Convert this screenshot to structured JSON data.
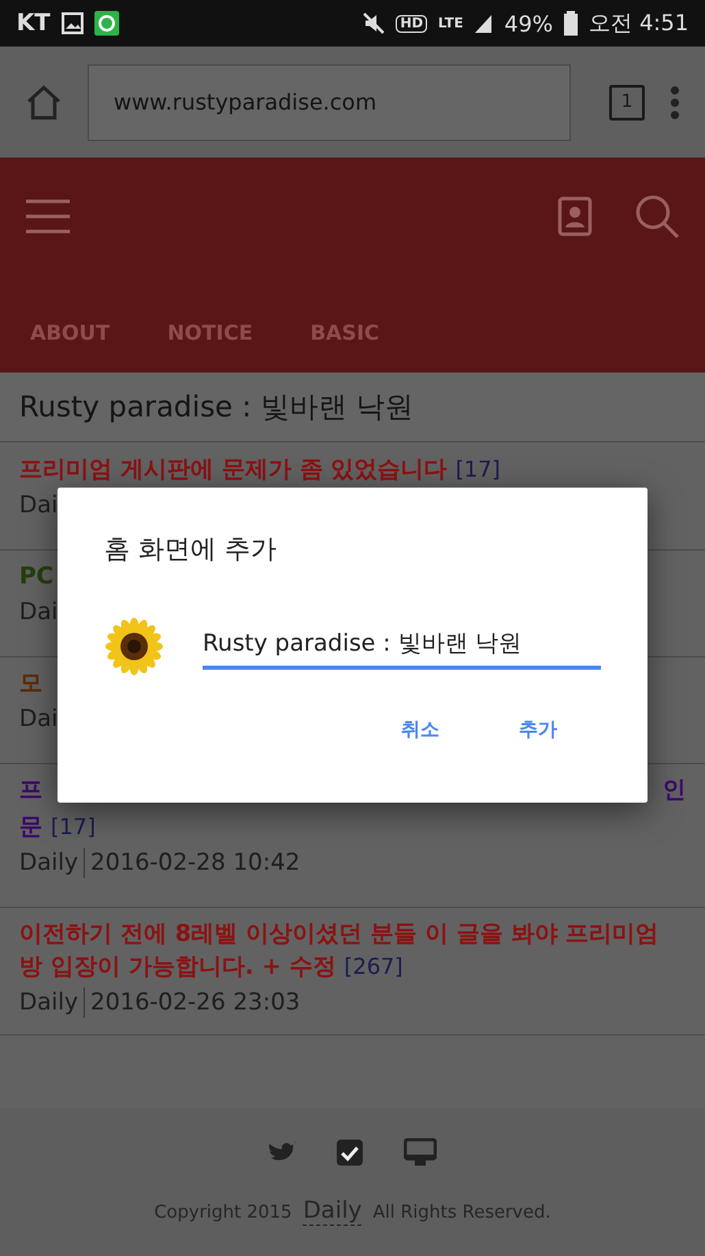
{
  "status_bar": {
    "carrier": "KT",
    "hd": "HD",
    "network": "LTE",
    "battery": "49%",
    "time": "오전 4:51"
  },
  "browser": {
    "url": "www.rustyparadise.com",
    "tab_count": "1"
  },
  "site_header": {
    "tabs": [
      {
        "label": "ABOUT",
        "selected": false
      },
      {
        "label": "NOTICE",
        "selected": false
      },
      {
        "label": "BASIC",
        "selected": false
      }
    ]
  },
  "page_title": "Rusty paradise : 빛바랜 낙원",
  "posts": [
    {
      "title": "프리미엄 게시판에 문제가 좀 있었습니다",
      "count": "[17]",
      "meta": "Dai",
      "color": "#8c1212"
    },
    {
      "title": "PC",
      "meta": "Dai",
      "color": "#24400c"
    },
    {
      "title": "모",
      "meta": "Dai",
      "color": "#5e2c04"
    },
    {
      "title": "프",
      "title_end": "인",
      "title_line2": "문",
      "count": "[17]",
      "category": "Daily",
      "date": "2016-02-28 10:42",
      "color": "#3c0a6a"
    },
    {
      "title": "이전하기 전에 8레벨 이상이셨던 분들 이 글을 봐야 프리미엄 방 입장이 가능합니다. + 수정",
      "count": "[267]",
      "category": "Daily",
      "date": "2016-02-26 23:03",
      "color": "#8c1212"
    }
  ],
  "footer": {
    "copyright": "Copyright 2015",
    "site_link": "Daily",
    "rights": "All Rights Reserved."
  },
  "dialog": {
    "title": "홈 화면에 추가",
    "name_value": "Rusty paradise : 빛바랜 낙원",
    "buttons": [
      "취소",
      "추가"
    ]
  }
}
